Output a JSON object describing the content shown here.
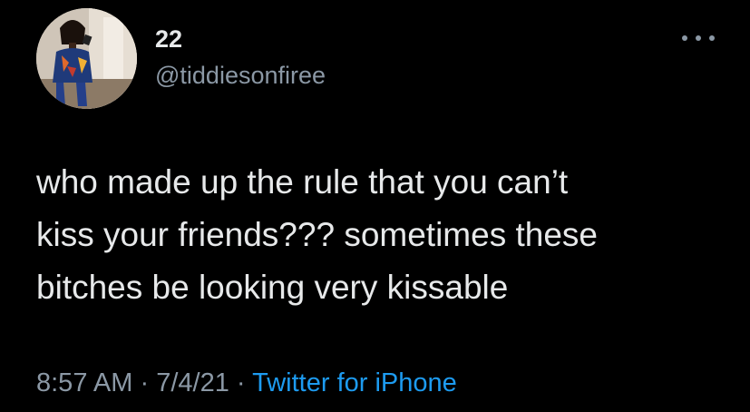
{
  "user": {
    "display_name": "22",
    "handle": "@tiddiesonfiree",
    "avatar_icon": "profile-photo"
  },
  "menu": {
    "icon": "more-horizontal-icon"
  },
  "tweet": {
    "lines": [
      "who made up the rule that you can’t",
      "kiss your friends??? sometimes these",
      "bitches be looking very kissable"
    ]
  },
  "meta": {
    "time": "8:57 AM",
    "separator": "·",
    "date": "7/4/21",
    "source": "Twitter for iPhone"
  },
  "colors": {
    "background": "#000000",
    "text": "#e7e9ea",
    "secondary": "#8b98a5",
    "link": "#1d9bf0"
  }
}
